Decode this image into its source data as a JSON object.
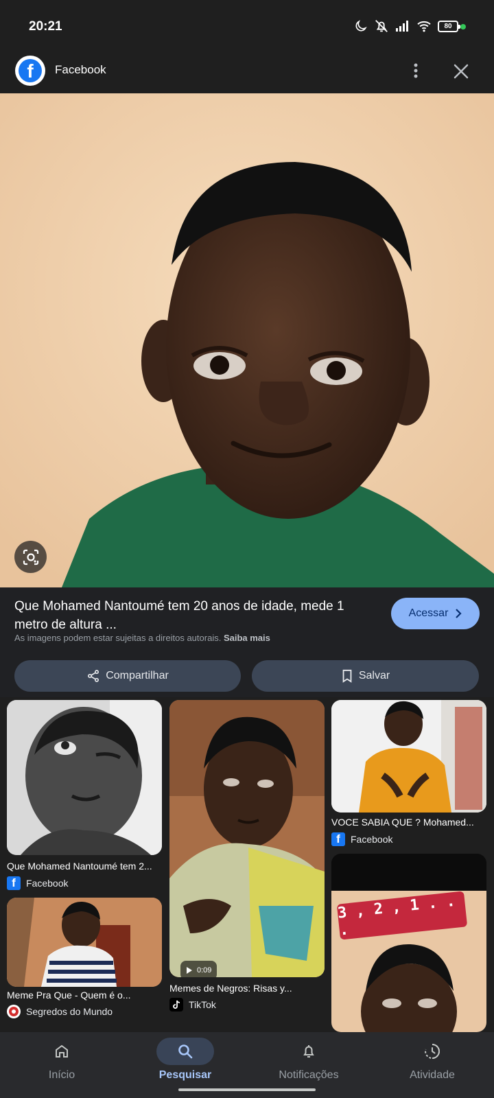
{
  "status_bar": {
    "time": "20:21",
    "battery": "80",
    "icons": [
      "moon-icon",
      "mute-icon",
      "signal-icon",
      "wifi-icon",
      "battery-icon"
    ]
  },
  "header": {
    "source_name": "Facebook",
    "menu_icon": "more-vert-icon",
    "close_icon": "close-icon"
  },
  "result": {
    "title": "Que Mohamed Nantoumé tem 20 anos de idade, mede 1 metro de altura ...",
    "copyright_text": "As imagens podem estar sujeitas a direitos autorais.",
    "learn_more": "Saiba mais",
    "visit_label": "Acessar",
    "share_label": "Compartilhar",
    "save_label": "Salvar"
  },
  "related": [
    {
      "title": "Que Mohamed Nantoumé tem 2...",
      "source": "Facebook"
    },
    {
      "title": "Memes de Negros: Risas y...",
      "source": "TikTok",
      "duration": "0:09"
    },
    {
      "title": "VOCE SABIA QUE ? Mohamed...",
      "source": "Facebook"
    },
    {
      "title": "Meme Pra Que - Quem é o...",
      "source": "Segredos do Mundo"
    },
    {
      "title": "",
      "source": "",
      "overlay_text": "3 , 2 , 1 . . ."
    }
  ],
  "bottom_nav": [
    {
      "label": "Início",
      "icon": "home-icon",
      "active": false
    },
    {
      "label": "Pesquisar",
      "icon": "search-icon",
      "active": true
    },
    {
      "label": "Notificações",
      "icon": "bell-icon",
      "active": false
    },
    {
      "label": "Atividade",
      "icon": "history-icon",
      "active": false
    }
  ],
  "colors": {
    "background": "#1f1f1f",
    "accent": "#8ab4f8",
    "button_bg": "#3c4656",
    "facebook_blue": "#1877f2"
  }
}
